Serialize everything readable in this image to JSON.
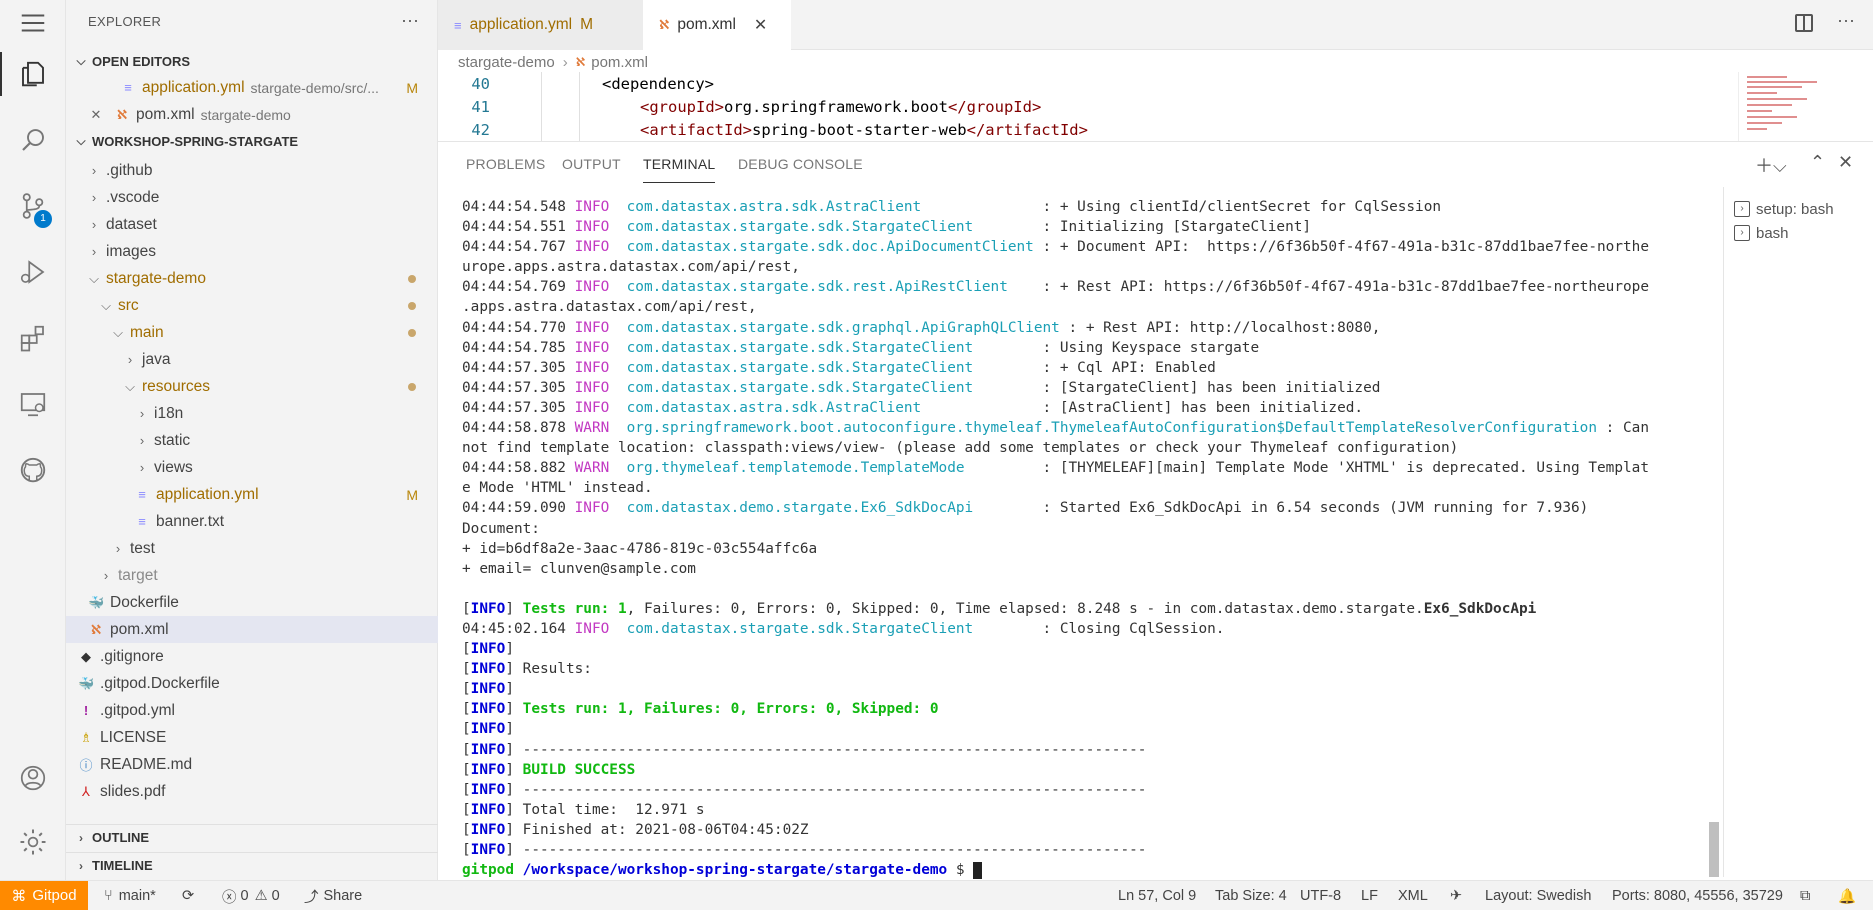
{
  "sidebar": {
    "title": "EXPLORER",
    "sections": {
      "open_editors": "OPEN EDITORS",
      "workspace": "WORKSHOP-SPRING-STARGATE",
      "outline": "OUTLINE",
      "timeline": "TIMELINE"
    },
    "open_editors": [
      {
        "name": "application.yml",
        "path": "stargate-demo/src/...",
        "status": "M"
      },
      {
        "name": "pom.xml",
        "path": "stargate-demo",
        "status": ""
      }
    ],
    "tree": {
      "github": ".github",
      "vscode": ".vscode",
      "dataset": "dataset",
      "images": "images",
      "stargate_demo": "stargate-demo",
      "src": "src",
      "main": "main",
      "java": "java",
      "resources": "resources",
      "i18n": "i18n",
      "static": "static",
      "views": "views",
      "application_yml": "application.yml",
      "application_yml_status": "M",
      "banner": "banner.txt",
      "test": "test",
      "target": "target",
      "dockerfile": "Dockerfile",
      "pom": "pom.xml",
      "gitignore": ".gitignore",
      "gitpod_dockerfile": ".gitpod.Dockerfile",
      "gitpod_yml": ".gitpod.yml",
      "license": "LICENSE",
      "readme": "README.md",
      "slides": "slides.pdf"
    }
  },
  "activity": {
    "scm_badge": "1"
  },
  "tabs": [
    {
      "label": "application.yml",
      "status": "M"
    },
    {
      "label": "pom.xml",
      "close": "✕"
    }
  ],
  "breadcrumb": {
    "folder": "stargate-demo",
    "sep": "›",
    "file": "pom.xml"
  },
  "code": [
    {
      "line": "40",
      "text": "<dependency>"
    },
    {
      "line": "41",
      "open": "<groupId>",
      "value": "org.springframework.boot",
      "close": "</groupId>"
    },
    {
      "line": "42",
      "open": "<artifactId>",
      "value": "spring-boot-starter-web",
      "close": "</artifactId>"
    }
  ],
  "panel": {
    "tabs": [
      "PROBLEMS",
      "OUTPUT",
      "TERMINAL",
      "DEBUG CONSOLE"
    ],
    "terminals": [
      "setup: bash",
      "bash"
    ]
  },
  "terminal": {
    "log": [
      {
        "t": "04:44:54.548",
        "lvl": "INFO",
        "cls": "com.datastax.astra.sdk.AstraClient             ",
        "msg": ": + Using clientId/clientSecret for CqlSession"
      },
      {
        "t": "04:44:54.551",
        "lvl": "INFO",
        "cls": "com.datastax.stargate.sdk.StargateClient       ",
        "msg": ": Initializing [StargateClient]"
      },
      {
        "t": "04:44:54.767",
        "lvl": "INFO",
        "cls": "com.datastax.stargate.sdk.doc.ApiDocumentClient",
        "msg": ": + Document API:  https://6f36b50f-4f67-491a-b31c-87dd1bae7fee-northe"
      },
      {
        "plain": "urope.apps.astra.datastax.com/api/rest,"
      },
      {
        "t": "04:44:54.769",
        "lvl": "INFO",
        "cls": "com.datastax.stargate.sdk.rest.ApiRestClient   ",
        "msg": ": + Rest API: https://6f36b50f-4f67-491a-b31c-87dd1bae7fee-northeurope"
      },
      {
        "plain": ".apps.astra.datastax.com/api/rest,"
      },
      {
        "t": "04:44:54.770",
        "lvl": "INFO",
        "cls": "com.datastax.stargate.sdk.graphql.ApiGraphQLClient",
        "msg": ": + Rest API: http://localhost:8080,"
      },
      {
        "t": "04:44:54.785",
        "lvl": "INFO",
        "cls": "com.datastax.stargate.sdk.StargateClient       ",
        "msg": ": Using Keyspace stargate"
      },
      {
        "t": "04:44:57.305",
        "lvl": "INFO",
        "cls": "com.datastax.stargate.sdk.StargateClient       ",
        "msg": ": + Cql API: Enabled"
      },
      {
        "t": "04:44:57.305",
        "lvl": "INFO",
        "cls": "com.datastax.stargate.sdk.StargateClient       ",
        "msg": ": [StargateClient] has been initialized"
      },
      {
        "t": "04:44:57.305",
        "lvl": "INFO",
        "cls": "com.datastax.astra.sdk.AstraClient             ",
        "msg": ": [AstraClient] has been initialized."
      },
      {
        "t": "04:44:58.878",
        "lvl": "WARN",
        "cls": "org.springframework.boot.autoconfigure.thymeleaf.ThymeleafAutoConfiguration$DefaultTemplateResolverConfiguration",
        "msg": ": Can"
      },
      {
        "plain": "not find template location: classpath:views/view- (please add some templates or check your Thymeleaf configuration)"
      },
      {
        "t": "04:44:58.882",
        "lvl": "WARN",
        "cls": "org.thymeleaf.templatemode.TemplateMode        ",
        "msg": ": [THYMELEAF][main] Template Mode 'XHTML' is deprecated. Using Templat"
      },
      {
        "plain": "e Mode 'HTML' instead."
      },
      {
        "t": "04:44:59.090",
        "lvl": "INFO",
        "cls": "com.datastax.demo.stargate.Ex6_SdkDocApi       ",
        "msg": ": Started Ex6_SdkDocApi in 6.54 seconds (JVM running for 7.936)"
      },
      {
        "plain": "Document:"
      },
      {
        "plain": "+ id=b6df8a2e-3aac-4786-819c-03c554affc6a"
      },
      {
        "plain": "+ email= clunven@sample.com"
      },
      {
        "plain": ""
      }
    ],
    "tests_line": {
      "tag": "INFO",
      "tests": "Tests run: 1",
      "rest": ", Failures: 0, Errors: 0, Skipped: 0, Time elapsed: 8.248 s - in com.datastax.demo.stargate.",
      "cls": "Ex6_SdkDocApi"
    },
    "closing": {
      "t": "04:45:02.164",
      "lvl": "INFO",
      "cls": "com.datastax.stargate.sdk.StargateClient       ",
      "msg": ": Closing CqlSession."
    },
    "summary": [
      {
        "tag": "INFO",
        "text": "",
        "style": ""
      },
      {
        "tag": "INFO",
        "text": "Results:",
        "style": ""
      },
      {
        "tag": "INFO",
        "text": "",
        "style": ""
      },
      {
        "tag": "INFO",
        "text": "Tests run: 1, Failures: 0, Errors: 0, Skipped: 0",
        "style": "green"
      },
      {
        "tag": "INFO",
        "text": "",
        "style": ""
      },
      {
        "tag": "INFO",
        "text": "------------------------------------------------------------------------",
        "style": ""
      },
      {
        "tag": "INFO",
        "text": "BUILD SUCCESS",
        "style": "green"
      },
      {
        "tag": "INFO",
        "text": "------------------------------------------------------------------------",
        "style": ""
      },
      {
        "tag": "INFO",
        "text": "Total time:  12.971 s",
        "style": ""
      },
      {
        "tag": "INFO",
        "text": "Finished at: 2021-08-06T04:45:02Z",
        "style": ""
      },
      {
        "tag": "INFO",
        "text": "------------------------------------------------------------------------",
        "style": ""
      }
    ],
    "prompt": {
      "user": "gitpod",
      "path": "/workspace/workshop-spring-stargate/stargate-demo",
      "symbol": "$"
    }
  },
  "statusbar": {
    "gitpod": "Gitpod",
    "branch": "main*",
    "errors": "0",
    "warnings": "0",
    "share": "Share",
    "position": "Ln 57, Col 9",
    "tab_size": "Tab Size: 4",
    "encoding": "UTF-8",
    "eol": "LF",
    "language": "XML",
    "layout": "Layout: Swedish",
    "ports": "Ports: 8080, 45556, 35729"
  }
}
